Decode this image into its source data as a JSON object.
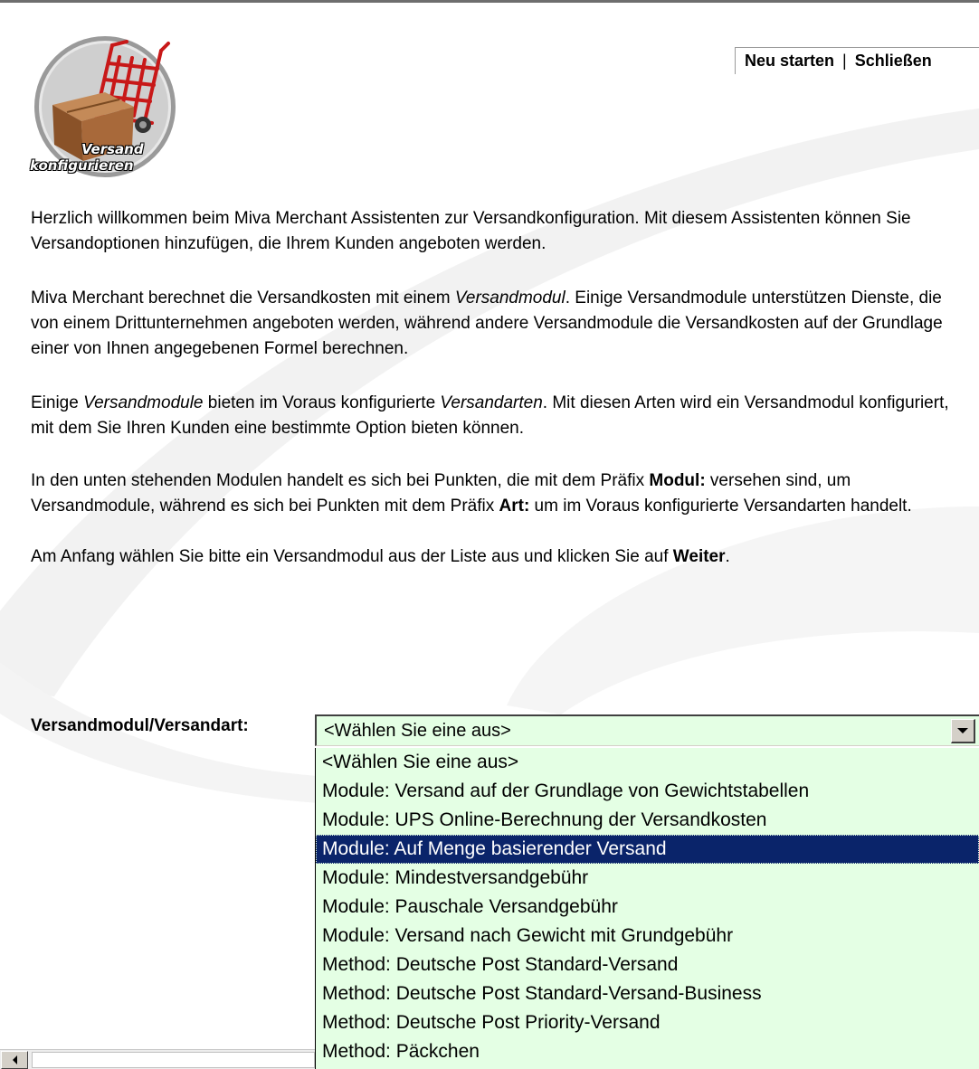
{
  "header": {
    "restart_link": "Neu starten",
    "separator": "|",
    "close_link": "Schließen"
  },
  "logo": {
    "icon": "hand-truck-box-icon",
    "line1": "Versand",
    "line2": "konfigurieren"
  },
  "intro": {
    "p1": "Herzlich willkommen beim Miva Merchant Assistenten zur Versandkonfiguration. Mit diesem Assistenten können Sie Versandoptionen hinzufügen, die Ihrem Kunden angeboten werden.",
    "p2_a": "Miva Merchant berechnet die Versandkosten mit einem ",
    "p2_em": "Versandmodul",
    "p2_b": ". Einige Versandmodule unterstützen Dienste, die von einem Drittunternehmen angeboten werden, während andere Versandmodule die Versandkosten auf der Grundlage einer von Ihnen angegebenen Formel berechnen.",
    "p3_a": "Einige ",
    "p3_em1": "Versandmodule",
    "p3_b": " bieten im Voraus konfigurierte ",
    "p3_em2": "Versandarten",
    "p3_c": ". Mit diesen Arten wird ein Versandmodul konfiguriert, mit dem Sie Ihren Kunden eine bestimmte Option bieten können.",
    "p4_a": "In den unten stehenden Modulen handelt es sich bei Punkten, die mit dem Präfix ",
    "p4_strong1": "Modul:",
    "p4_b": " versehen sind, um Versandmodule, während es sich bei Punkten mit dem Präfix ",
    "p4_strong2": "Art:",
    "p4_c": " um im Voraus konfigurierte Versandarten handelt.",
    "p5_a": "Am Anfang wählen Sie bitte ein Versandmodul aus der Liste aus und klicken Sie auf ",
    "p5_strong": "Weiter",
    "p5_b": "."
  },
  "form": {
    "label": "Versandmodul/Versandart:",
    "selected_value": "<Wählen Sie eine aus>",
    "options": [
      "<Wählen Sie eine aus>",
      "Module: Versand auf der Grundlage von Gewichtstabellen",
      "Module: UPS Online-Berechnung der Versandkosten",
      "Module: Auf Menge basierender Versand",
      "Module: Mindestversandgebühr",
      "Module: Pauschale Versandgebühr",
      "Module: Versand nach Gewicht mit Grundgebühr",
      "Method: Deutsche Post Standard-Versand",
      "Method: Deutsche Post Standard-Versand-Business",
      "Method: Deutsche Post Priority-Versand",
      "Method: Päckchen"
    ],
    "highlighted_option": "Module: Auf Menge basierender Versand"
  },
  "colors": {
    "select_bg": "#e4ffe4",
    "highlight_bg": "#0a246a",
    "highlight_text": "#ffffff"
  }
}
